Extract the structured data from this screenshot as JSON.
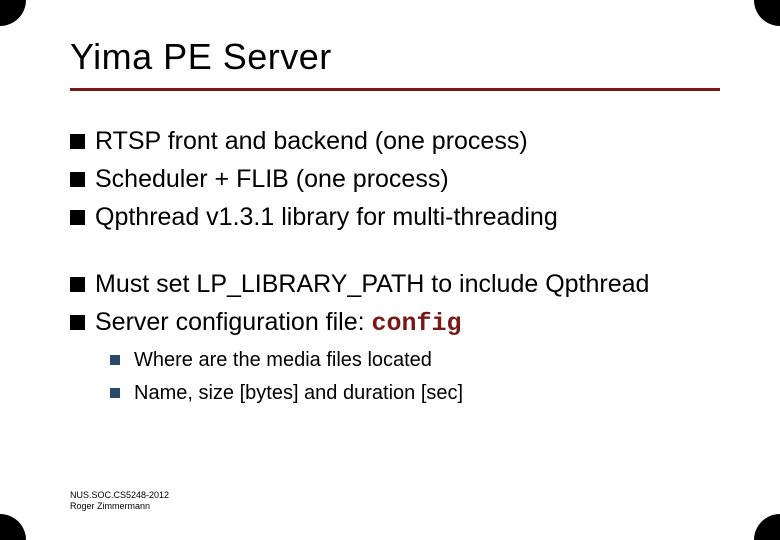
{
  "title": "Yima PE Server",
  "groups": [
    {
      "items": [
        {
          "level": 1,
          "text": "RTSP front and backend (one process)"
        },
        {
          "level": 1,
          "text": "Scheduler + FLIB (one process)"
        },
        {
          "level": 1,
          "text": "Qpthread v1.3.1 library for multi-threading"
        }
      ]
    },
    {
      "items": [
        {
          "level": 1,
          "text": "Must set LP_LIBRARY_PATH to include Qpthread"
        },
        {
          "level": 1,
          "text": "Server configuration file: ",
          "code_suffix": "config"
        },
        {
          "level": 2,
          "text": "Where are the media files located"
        },
        {
          "level": 2,
          "text": "Name, size [bytes] and duration [sec]"
        }
      ]
    }
  ],
  "footer": {
    "line1": "NUS.SOC.CS5248-2012",
    "line2": "Roger Zimmermann"
  },
  "colors": {
    "accent": "#7a1818",
    "sub_bullet": "#2a4a6a"
  }
}
